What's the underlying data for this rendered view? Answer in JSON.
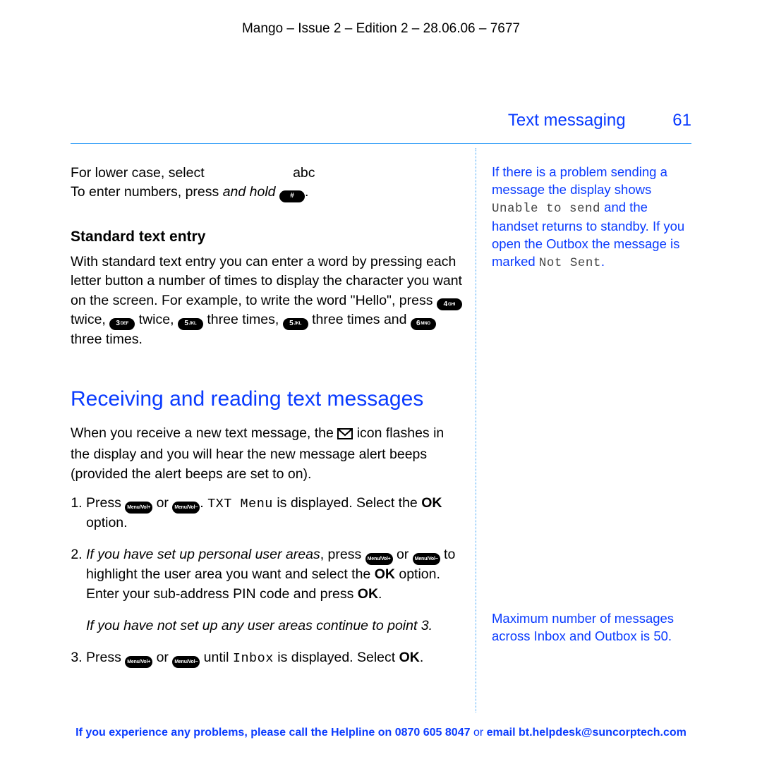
{
  "doc_header": "Mango – Issue 2 – Edition 2 – 28.06.06 – 7677",
  "section": {
    "title": "Text messaging",
    "page_number": "61"
  },
  "left": {
    "lowercase_line_a": "For lower case, select",
    "lowercase_abc": "abc",
    "numbers_line_a": "To enter numbers, press ",
    "numbers_line_b": "and hold",
    "hash_key": "#",
    "period": ".",
    "subhead1": "Standard text entry",
    "std_entry_1": "With standard text entry you can enter a word by pressing each letter button a number of times to display the character you want on the screen. For example, to write the word \"Hello\", press ",
    "key4": "4",
    "key4sub": "GHI",
    "twice1": " twice, ",
    "key3": "3",
    "key3sub": "DEF",
    "twice2": " twice, ",
    "key5a": "5",
    "key5sub": "JKL",
    "three1": " three times, ",
    "key5b": "5",
    "three2": " three times and ",
    "key6": "6",
    "key6sub": "MNO",
    "three3": " three times.",
    "h2": "Receiving and reading text messages",
    "recv_p_a": "When you receive a new text message, the ",
    "recv_p_b": " icon flashes in the display and you will hear the new message alert beeps (provided the alert beeps are set to on).",
    "menu_plus": "Menu/Vol+",
    "menu_minus": "Menu/Vol−",
    "step1_a": "Press ",
    "step1_b": " or ",
    "step1_c": ". ",
    "step1_txt": "TXT Menu",
    "step1_d": " is displayed. Select the ",
    "step1_ok": "OK",
    "step1_e": " option.",
    "step2_a": "If you have set up personal user areas",
    "step2_b": ", press ",
    "step2_c": " or ",
    "step2_d": " to highlight the user area you want and select the ",
    "step2_e": " option. Enter your sub-address PIN code and press ",
    "step2_f": ".",
    "step2_note": "If you have not set up any user areas continue to point 3.",
    "step3_a": "Press ",
    "step3_b": " or ",
    "step3_c": " until ",
    "step3_inbox": "Inbox",
    "step3_d": " is displayed. Select ",
    "step3_e": "."
  },
  "right": {
    "note1_a": "If there is a problem sending a message the display shows ",
    "note1_unable": "Unable to send",
    "note1_b": " and the handset returns to standby. If you open the Outbox the message is marked ",
    "note1_notsent": "Not Sent",
    "note1_c": ".",
    "note2": "Maximum number of messages across Inbox and Outbox is 50."
  },
  "footer": {
    "a": "If you experience any problems, please call the Helpline on ",
    "phone": "0870 605 8047",
    "b": " or ",
    "c": "email bt.helpdesk@suncorptech.com"
  }
}
